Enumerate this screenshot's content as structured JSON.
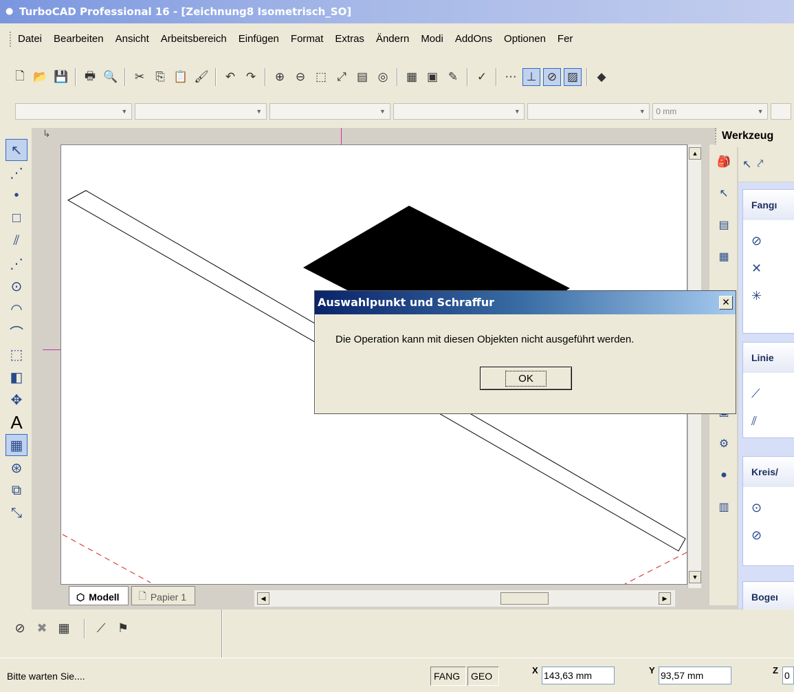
{
  "window": {
    "title": "TurboCAD Professional 16 - [Zeichnung8 Isometrisch_SO]"
  },
  "menu": [
    "Datei",
    "Bearbeiten",
    "Ansicht",
    "Arbeitsbereich",
    "Einfügen",
    "Format",
    "Extras",
    "Ändern",
    "Modi",
    "AddOns",
    "Optionen",
    "Fer"
  ],
  "property_bar": {
    "line_width": "0 mm"
  },
  "canvas": {
    "tabs": [
      {
        "label": "Modell",
        "active": true
      },
      {
        "label": "Papier 1",
        "active": false
      }
    ]
  },
  "right_panel": {
    "header": "Werkzeug",
    "groups": [
      {
        "title": "Fangı"
      },
      {
        "title": "Linie"
      },
      {
        "title": "Kreis/"
      },
      {
        "title": "Bogeı"
      }
    ]
  },
  "dialog": {
    "title": "Auswahlpunkt und Schraffur",
    "message": "Die Operation kann mit diesen Objekten nicht ausgeführt werden.",
    "ok_label": "OK",
    "close_glyph": "✕"
  },
  "status": {
    "message": "Bitte warten Sie....",
    "fang": "FANG",
    "geo": "GEO",
    "x_value": "143,63 mm",
    "y_value": "93,57 mm",
    "z_value": "0"
  },
  "colors": {
    "title_gradient_start": "#7a96df",
    "dialog_title_start": "#0a246a",
    "guide_line": "#cc2222"
  },
  "icons": {
    "toolbar": [
      "new-icon",
      "open-icon",
      "save-icon",
      "print-icon",
      "print-preview-icon",
      "cut-icon",
      "copy-icon",
      "paste-icon",
      "format-painter-icon",
      "undo-icon",
      "redo-icon",
      "zoom-in-icon",
      "zoom-out-icon",
      "zoom-window-icon",
      "zoom-extents-icon",
      "view-icon",
      "pan-icon",
      "layer-icon",
      "design-director-icon",
      "draw-icon",
      "spell-check-icon",
      "grid-icon",
      "snap-icon",
      "snap-toggle-icon",
      "hatch-icon",
      "object-icon"
    ],
    "left_tools": [
      "select-arrow-icon",
      "point-icon",
      "point-dot-icon",
      "rectangle-icon",
      "parallel-line-icon",
      "multi-line-icon",
      "circle-icon",
      "arc-icon",
      "curve-icon",
      "box-3d-icon",
      "shape-3d-icon",
      "move-icon",
      "text-icon",
      "hatch-tool-icon",
      "center-snap-icon",
      "insert-icon",
      "dimension-icon"
    ]
  }
}
